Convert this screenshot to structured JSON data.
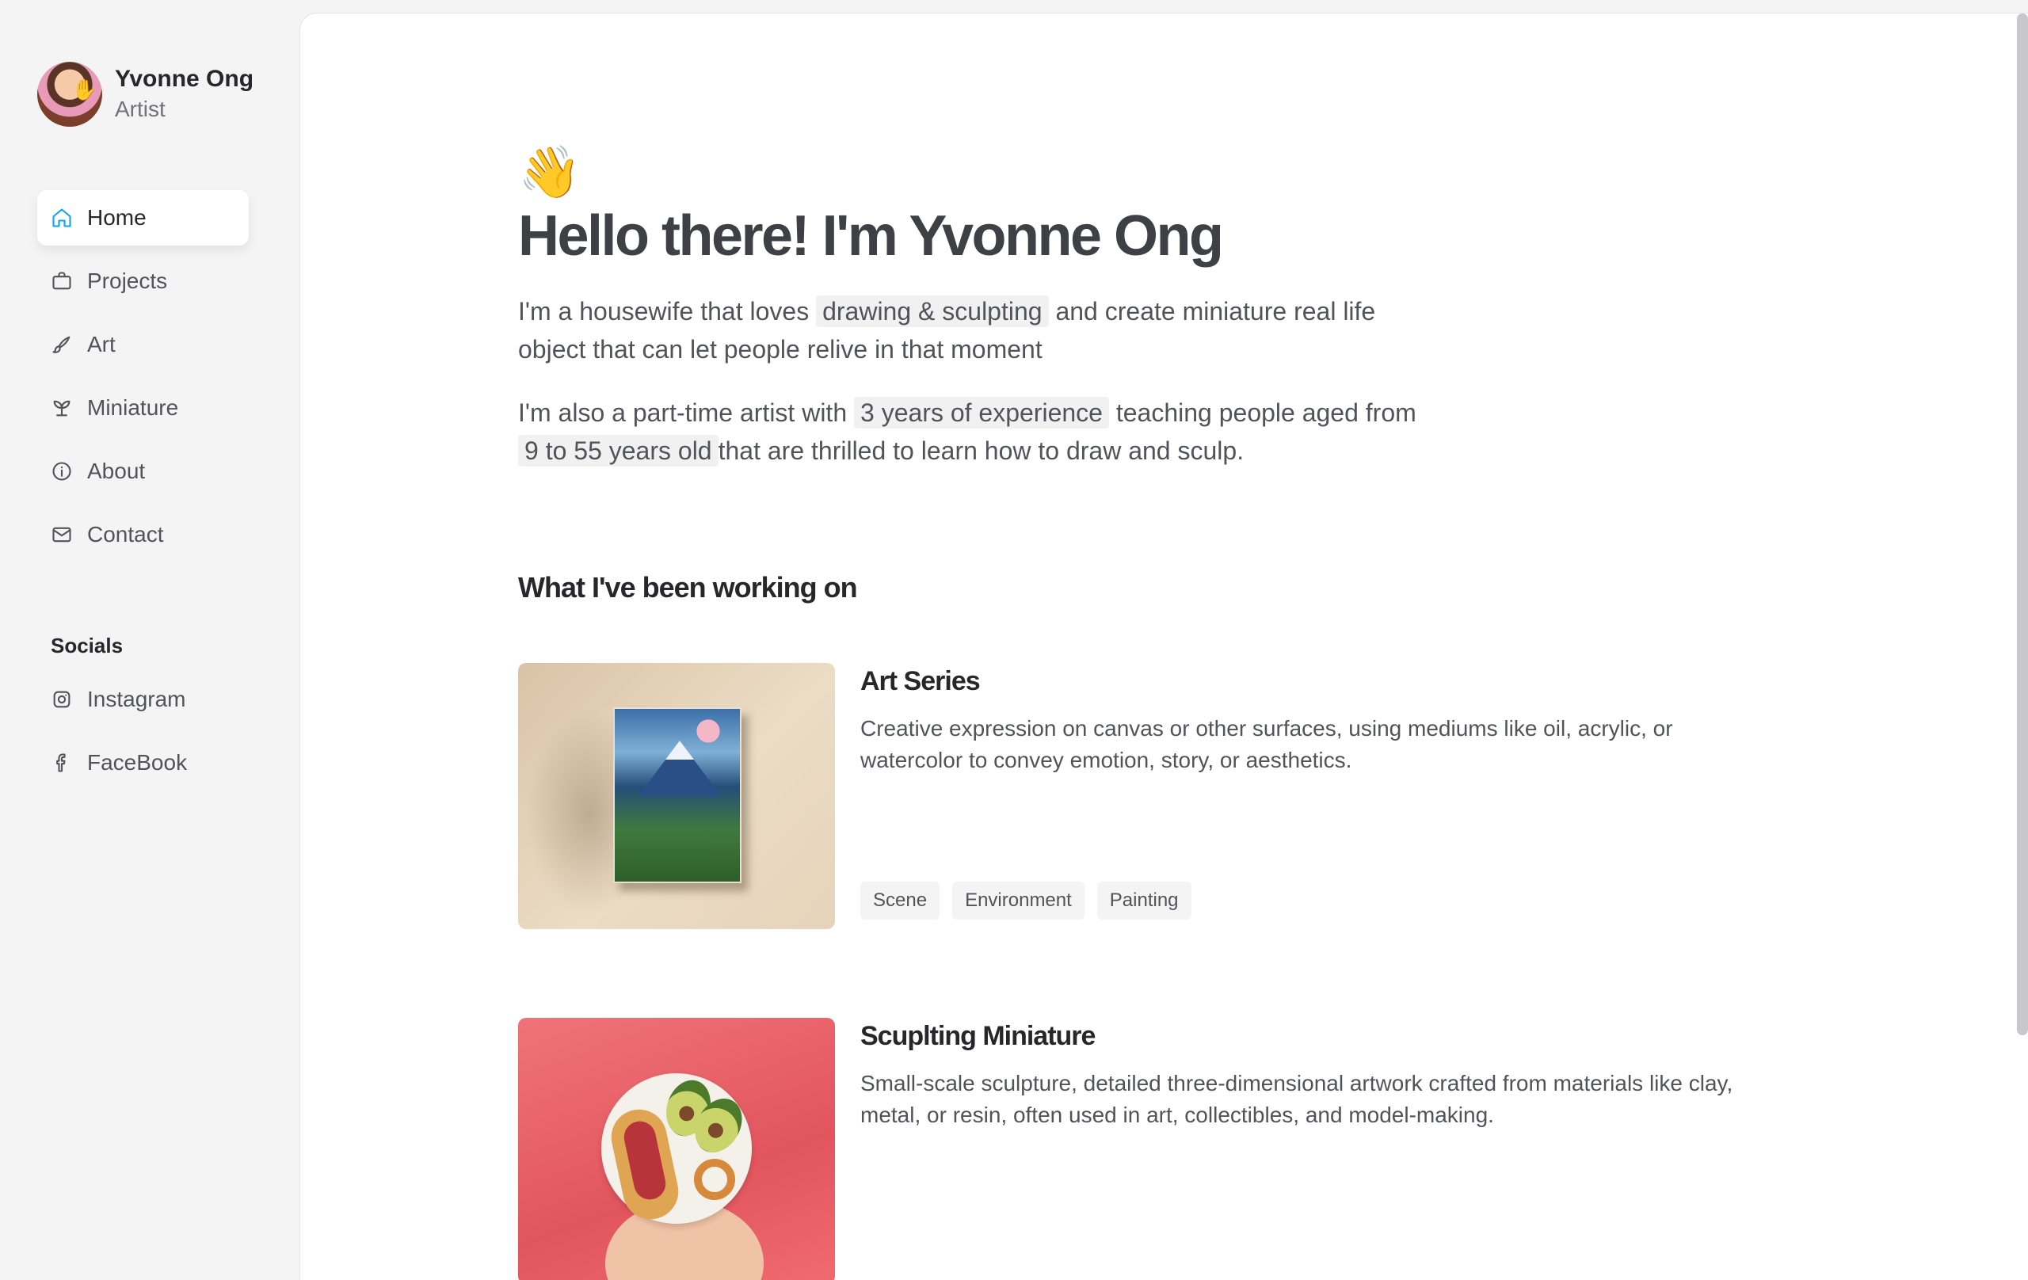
{
  "profile": {
    "name": "Yvonne Ong",
    "role": "Artist"
  },
  "nav": {
    "items": [
      {
        "label": "Home",
        "icon": "home-icon"
      },
      {
        "label": "Projects",
        "icon": "briefcase-icon"
      },
      {
        "label": "Art",
        "icon": "brush-icon"
      },
      {
        "label": "Miniature",
        "icon": "plant-icon"
      },
      {
        "label": "About",
        "icon": "info-icon"
      },
      {
        "label": "Contact",
        "icon": "mail-icon"
      }
    ]
  },
  "socials": {
    "title": "Socials",
    "items": [
      {
        "label": "Instagram",
        "icon": "instagram-icon"
      },
      {
        "label": "FaceBook",
        "icon": "facebook-icon"
      }
    ]
  },
  "hero": {
    "emoji": "👋",
    "title": "Hello there! I'm Yvonne Ong",
    "p1": {
      "pre": "I'm a housewife that loves",
      "highlight": "drawing & sculpting",
      "post": "and create miniature real life object that can let people relive in that moment"
    },
    "p2": {
      "pre": "I'm also a part-time artist with",
      "highlight1": "3 years of experience",
      "mid": "teaching people aged from",
      "highlight2": "9 to 55 years old",
      "post": "that are thrilled to learn how to draw and sculp."
    }
  },
  "work": {
    "title": "What I've been working on",
    "projects": [
      {
        "title": "Art Series",
        "description": "Creative expression on canvas or other surfaces, using mediums like oil, acrylic, or watercolor to convey emotion, story, or aesthetics.",
        "tags": [
          "Scene",
          "Environment",
          "Painting"
        ]
      },
      {
        "title": "Scuplting Miniature",
        "description": "Small-scale sculpture, detailed three-dimensional artwork crafted from materials like clay, metal, or resin, often used in art, collectibles, and model-making."
      }
    ]
  },
  "colors": {
    "accent": "#0ea5e9",
    "background": "#f4f4f5",
    "text": "#3f3f46"
  }
}
